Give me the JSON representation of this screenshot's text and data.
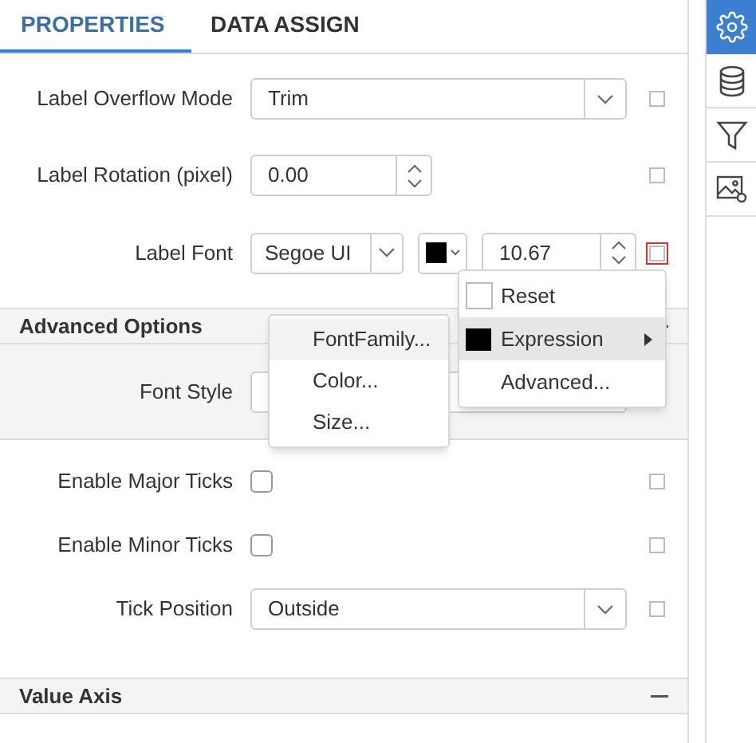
{
  "tabs": [
    {
      "label": "PROPERTIES",
      "selected": true
    },
    {
      "label": "DATA ASSIGN",
      "selected": false
    }
  ],
  "side_tools": [
    {
      "kind": "gear",
      "selected": true
    },
    {
      "kind": "database",
      "selected": false
    },
    {
      "kind": "filter",
      "selected": false
    },
    {
      "kind": "image",
      "selected": false
    }
  ],
  "rows": [
    {
      "kind": "dropdown",
      "label": "Label Overflow Mode",
      "value": "Trim",
      "focused": false
    },
    {
      "kind": "spinner",
      "label": "Label Rotation (pixel)",
      "value": "0.00",
      "focused": false
    },
    {
      "kind": "font",
      "label": "Label Font",
      "font": "Segoe UI",
      "color": "#000000",
      "size": "10.67",
      "focused": true
    }
  ],
  "advanced_section": {
    "title": "Advanced Options",
    "expanded": true,
    "rows": [
      {
        "kind": "field",
        "label": "Font Style"
      }
    ]
  },
  "tick_rows": [
    {
      "kind": "checkbox",
      "label": "Enable Major Ticks",
      "checked": false,
      "focused": false
    },
    {
      "kind": "checkbox",
      "label": "Enable Minor Ticks",
      "checked": false,
      "focused": false
    },
    {
      "kind": "dropdown",
      "label": "Tick Position",
      "value": "Outside",
      "focused": false
    }
  ],
  "value_axis_section": {
    "title": "Value Axis",
    "expanded": true
  },
  "context_menu": [
    {
      "kind": "check",
      "label": "Reset",
      "selected": false
    },
    {
      "kind": "swatch",
      "label": "Expression",
      "selected": true,
      "submenu": true
    },
    {
      "kind": "plain",
      "label": "Advanced...",
      "selected": false
    }
  ],
  "submenu": [
    {
      "label": "FontFamily...",
      "selected": true
    },
    {
      "label": "Color...",
      "selected": false
    },
    {
      "label": "Size...",
      "selected": false
    }
  ]
}
